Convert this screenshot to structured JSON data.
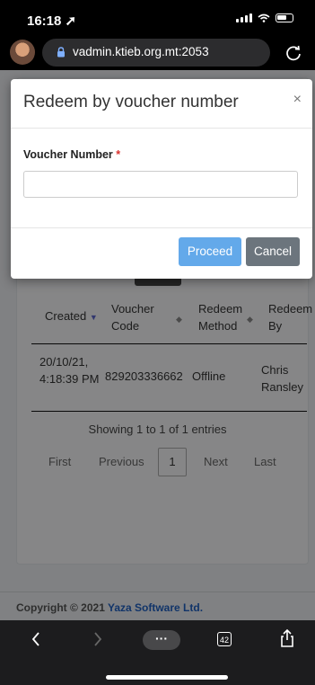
{
  "status": {
    "time": "16:18 ➚"
  },
  "browser": {
    "url": "vadmin.ktieb.org.mt:2053"
  },
  "modal": {
    "title": "Redeem by voucher number",
    "close": "×",
    "field_label": "Voucher Number",
    "required_mark": "*",
    "input_value": "",
    "proceed": "Proceed",
    "cancel": "Cancel"
  },
  "table": {
    "headers": [
      {
        "label": "Created",
        "sort_glyph": "▼"
      },
      {
        "label": "Voucher Code",
        "sort_glyph": "◆"
      },
      {
        "label": "Redeem Method",
        "sort_glyph": "◆"
      },
      {
        "label": "Redeem By",
        "sort_glyph": ""
      }
    ],
    "rows": [
      {
        "created": "20/10/21, 4:18:39 PM",
        "voucher_code": "829203336662",
        "method": "Offline",
        "by": "Chris Ransley"
      }
    ],
    "showing": "Showing 1 to 1 of 1 entries",
    "pager": {
      "first": "First",
      "previous": "Previous",
      "current": "1",
      "next": "Next",
      "last": "Last"
    }
  },
  "footer": {
    "text": "Copyright © 2021",
    "link": "Yaza Software Ltd."
  },
  "toolbar": {
    "more": "···",
    "tabs_count": "42"
  },
  "icons": {
    "back": "chevron-left",
    "forward": "chevron-right",
    "share": "share",
    "reload": "reload"
  }
}
